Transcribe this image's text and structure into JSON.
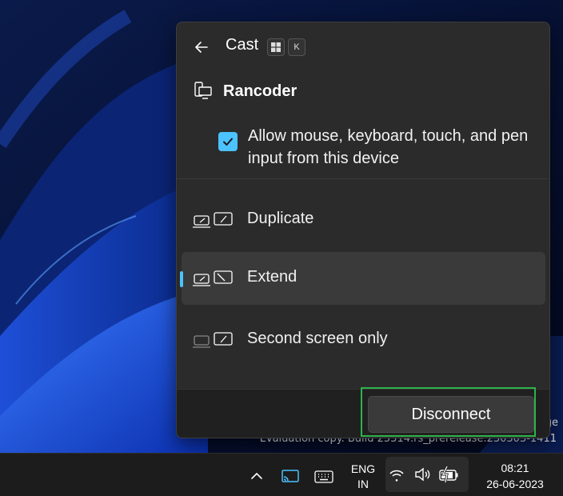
{
  "flyout": {
    "title": "Cast",
    "shortcut_keys": [
      "K"
    ],
    "device": {
      "name": "Rancoder",
      "icon": "cast-device-icon"
    },
    "allow_input": {
      "label": "Allow mouse, keyboard, touch, and pen input from this device",
      "checked": true
    },
    "projection_modes": [
      {
        "label": "Duplicate",
        "icon": "duplicate-screens-icon",
        "selected": false
      },
      {
        "label": "Extend",
        "icon": "extend-screens-icon",
        "selected": true
      },
      {
        "label": "Second screen only",
        "icon": "second-screen-only-icon",
        "selected": false
      }
    ],
    "disconnect_label": "Disconnect"
  },
  "desktop": {
    "watermark_line1": "ge",
    "watermark_line2": "Evaluation copy. Build 25314.rs_prerelease.230303-1411"
  },
  "taskbar": {
    "lang_line1": "ENG",
    "lang_line2": "IN",
    "time": "08:21",
    "date": "26-06-2023",
    "accent_color": "#4cc2ff",
    "highlight_color": "#2fb24a"
  }
}
